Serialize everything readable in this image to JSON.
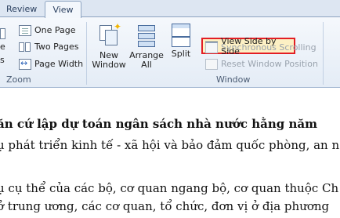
{
  "tabs": {
    "review": "Review",
    "view": "View"
  },
  "zoom_group": {
    "label": "Zoom",
    "one_page": "One Page",
    "two_pages": "Two Pages",
    "page_width": "Page Width",
    "partial_left_1": "e",
    "partial_left_2": "s"
  },
  "window_group": {
    "label": "Window",
    "new_window_line1": "New",
    "new_window_line2": "Window",
    "arrange_all_line1": "Arrange",
    "arrange_all_line2": "All",
    "split": "Split",
    "view_side_by_side": "View Side by Side",
    "synchronous_scrolling": "Synchronous Scrolling",
    "reset_window_position": "Reset Window Position"
  },
  "document": {
    "heading": "ăn cứ lập dự toán ngân sách nhà nước hằng năm",
    "line2": "ụ phát triển kinh tế - xã hội và bảo đảm quốc phòng, an n",
    "line3": "",
    "line4": "ụ cụ thể của các bộ, cơ quan ngang bộ, cơ quan thuộc Ch",
    "line5": "ở trung ương, các cơ quan, tổ chức, đơn vị ở địa phương"
  },
  "colors": {
    "highlight_border": "#e31e24",
    "highlight_fill": "#fdf0c4",
    "ribbon_bg": "#e4ecf6"
  }
}
